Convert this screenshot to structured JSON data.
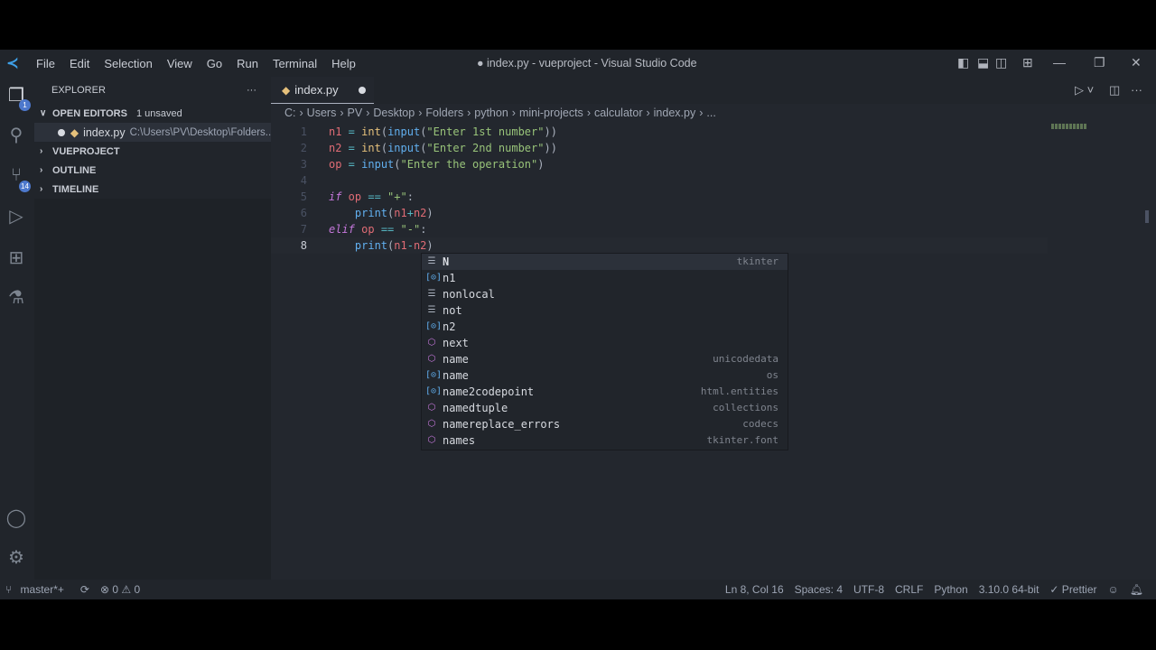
{
  "titlebar": {
    "menu": [
      "File",
      "Edit",
      "Selection",
      "View",
      "Go",
      "Run",
      "Terminal",
      "Help"
    ],
    "title": "● index.py - vueproject - Visual Studio Code"
  },
  "activity": {
    "explorer_badge": "1",
    "scm_badge": "14"
  },
  "sidebar": {
    "title": "EXPLORER",
    "more": "···",
    "open_editors": "OPEN EDITORS",
    "unsaved": "1 unsaved",
    "open_file": "index.py",
    "open_file_path": "C:\\Users\\PV\\Desktop\\Folders...",
    "sections": [
      "VUEPROJECT",
      "OUTLINE",
      "TIMELINE"
    ]
  },
  "tab": {
    "label": "index.py"
  },
  "breadcrumbs": [
    "C:",
    "Users",
    "PV",
    "Desktop",
    "Folders",
    "python",
    "mini-projects",
    "calculator",
    "index.py",
    "..."
  ],
  "code": [
    {
      "n": "1",
      "t": [
        [
          "v",
          "n1"
        ],
        [
          "o",
          " = "
        ],
        [
          "b",
          "int"
        ],
        [
          "p",
          "("
        ],
        [
          "f",
          "input"
        ],
        [
          "p",
          "("
        ],
        [
          "s",
          "\"Enter 1st number\""
        ],
        [
          "p",
          "))"
        ]
      ]
    },
    {
      "n": "2",
      "t": [
        [
          "v",
          "n2"
        ],
        [
          "o",
          " = "
        ],
        [
          "b",
          "int"
        ],
        [
          "p",
          "("
        ],
        [
          "f",
          "input"
        ],
        [
          "p",
          "("
        ],
        [
          "s",
          "\"Enter 2nd number\""
        ],
        [
          "p",
          "))"
        ]
      ]
    },
    {
      "n": "3",
      "t": [
        [
          "v",
          "op"
        ],
        [
          "o",
          " = "
        ],
        [
          "f",
          "input"
        ],
        [
          "p",
          "("
        ],
        [
          "s",
          "\"Enter the operation\""
        ],
        [
          "p",
          ")"
        ]
      ]
    },
    {
      "n": "4",
      "t": []
    },
    {
      "n": "5",
      "t": [
        [
          "k",
          "if"
        ],
        [
          "v",
          " op"
        ],
        [
          "o",
          " == "
        ],
        [
          "s",
          "\"+\""
        ],
        [
          "p",
          ":"
        ]
      ]
    },
    {
      "n": "6",
      "t": [
        [
          "p",
          "    "
        ],
        [
          "f",
          "print"
        ],
        [
          "p",
          "("
        ],
        [
          "v",
          "n1"
        ],
        [
          "o",
          "+"
        ],
        [
          "v",
          "n2"
        ],
        [
          "p",
          ")"
        ]
      ]
    },
    {
      "n": "7",
      "t": [
        [
          "k",
          "elif"
        ],
        [
          "v",
          " op"
        ],
        [
          "o",
          " == "
        ],
        [
          "s",
          "\"-\""
        ],
        [
          "p",
          ":"
        ]
      ]
    },
    {
      "n": "8",
      "t": [
        [
          "p",
          "    "
        ],
        [
          "f",
          "print"
        ],
        [
          "p",
          "("
        ],
        [
          "v",
          "n1"
        ],
        [
          "o",
          "-"
        ],
        [
          "v",
          "n2"
        ],
        [
          "p",
          ")"
        ]
      ]
    }
  ],
  "suggestions": [
    {
      "icon": "kw",
      "label": "N",
      "detail": "tkinter"
    },
    {
      "icon": "var",
      "label": "n1",
      "detail": ""
    },
    {
      "icon": "kw",
      "label": "nonlocal",
      "detail": ""
    },
    {
      "icon": "kw",
      "label": "not",
      "detail": ""
    },
    {
      "icon": "var",
      "label": "n2",
      "detail": ""
    },
    {
      "icon": "mod",
      "label": "next",
      "detail": ""
    },
    {
      "icon": "mod",
      "label": "name",
      "detail": "unicodedata"
    },
    {
      "icon": "var",
      "label": "name",
      "detail": "os"
    },
    {
      "icon": "var",
      "label": "name2codepoint",
      "detail": "html.entities"
    },
    {
      "icon": "mod",
      "label": "namedtuple",
      "detail": "collections"
    },
    {
      "icon": "mod",
      "label": "namereplace_errors",
      "detail": "codecs"
    },
    {
      "icon": "mod",
      "label": "names",
      "detail": "tkinter.font"
    }
  ],
  "status": {
    "branch": "master*+",
    "problems": "⊗ 0 ⚠ 0",
    "position": "Ln 8, Col 16",
    "spaces": "Spaces: 4",
    "encoding": "UTF-8",
    "eol": "CRLF",
    "language": "Python",
    "interpreter": "3.10.0 64-bit",
    "formatter": "✓ Prettier"
  }
}
